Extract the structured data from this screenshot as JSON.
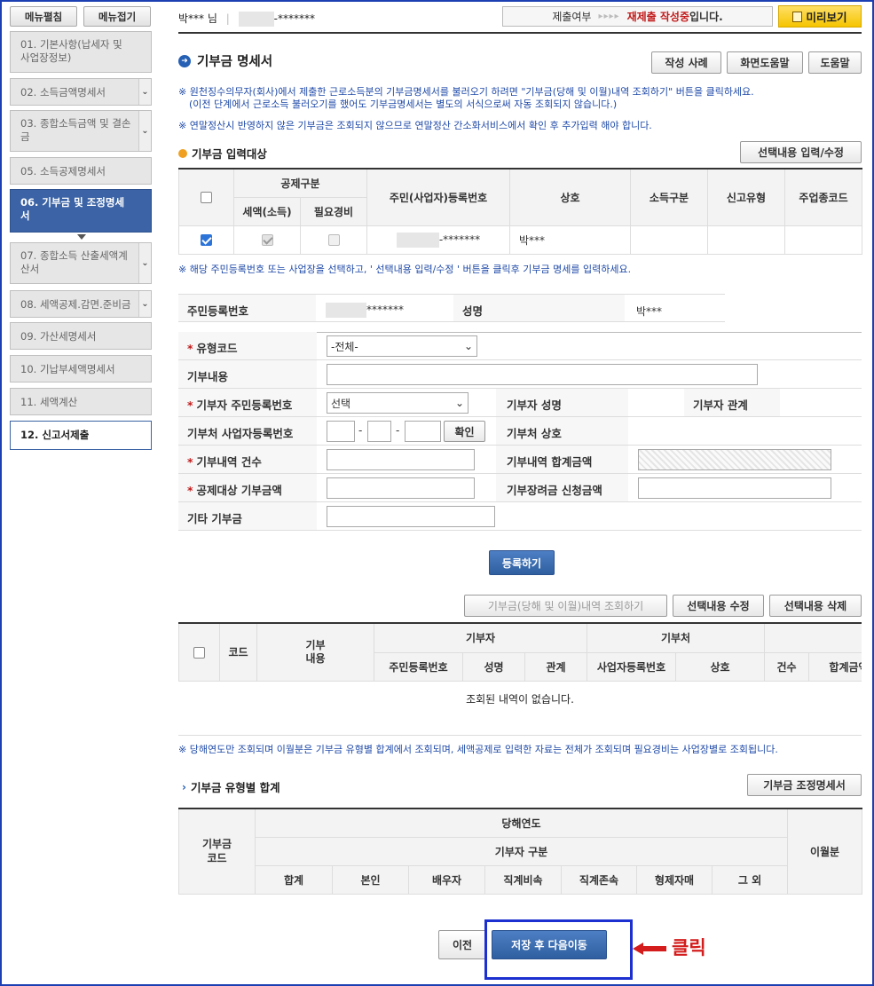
{
  "sidebar": {
    "top_buttons": [
      "메뉴펼침",
      "메뉴접기"
    ],
    "items": [
      {
        "label": "01. 기본사항(납세자 및 사업장정보)",
        "state": "normal",
        "chevron": false
      },
      {
        "label": "02. 소득금액명세서",
        "state": "normal",
        "chevron": true
      },
      {
        "label": "03. 종합소득금액 및 결손금",
        "state": "normal",
        "chevron": true
      },
      {
        "label": "05. 소득공제명세서",
        "state": "normal",
        "chevron": false
      },
      {
        "label": "06. 기부금 및 조정명세서",
        "state": "active",
        "chevron": false
      },
      {
        "label": "07. 종합소득 산출세액계산서",
        "state": "normal",
        "chevron": true
      },
      {
        "label": "08. 세액공제.감면.준비금",
        "state": "normal",
        "chevron": true
      },
      {
        "label": "09. 가산세명세서",
        "state": "normal",
        "chevron": false
      },
      {
        "label": "10. 기납부세액명세서",
        "state": "normal",
        "chevron": false
      },
      {
        "label": "11. 세액계산",
        "state": "normal",
        "chevron": false
      },
      {
        "label": "12. 신고서제출",
        "state": "current",
        "chevron": false
      }
    ]
  },
  "header": {
    "user_name": "박*** 님",
    "user_id_suffix": "-*******",
    "status_label": "제출여부",
    "status_arrows": "▸▸▸▸",
    "status_red": "재제출 작성중",
    "status_tail": "입니다.",
    "preview_label": "미리보기"
  },
  "page": {
    "title": "기부금 명세서",
    "buttons": [
      "작성 사례",
      "화면도움말",
      "도움말"
    ],
    "notes": [
      "※ 원천징수의무자(회사)에서 제출한 근로소득분의 기부금명세서를 불러오기 하려면 \"기부금(당해 및 이월)내역 조회하기\" 버튼을 클릭하세요.",
      "(이전 단계에서 근로소득 불러오기를 했어도 기부금명세서는 별도의 서식으로써 자동 조회되지 않습니다.)",
      "※ 연말정산시 반영하지 않은 기부금은 조회되지 않으므로 연말정산 간소화서비스에서 확인 후 추가입력 해야 합니다."
    ]
  },
  "target": {
    "section_title": "기부금 입력대상",
    "edit_button": "선택내용 입력/수정",
    "headers": {
      "deduction": "공제구분",
      "tax_credit": "세액(소득)",
      "expense": "필요경비",
      "reg_no": "주민(사업자)등록번호",
      "name": "상호",
      "income_type": "소득구분",
      "report_type": "신고유형",
      "industry": "주업종코드"
    },
    "row": {
      "reg_no_suffix": "-*******",
      "name": "박***",
      "checked": true,
      "tax_credit": true,
      "expense": false
    },
    "hint": "※ 해당 주민등록번호 또는 사업장을 선택하고, ' 선택내용 입력/수정 ' 버튼을 클릭후 기부금 명세를 입력하세요."
  },
  "form": {
    "resident_label": "주민등록번호",
    "resident_value_suffix": "*******",
    "name_label": "성명",
    "name_value": "박***",
    "type_label": "유형코드",
    "type_value": "-전체-",
    "content_label": "기부내용",
    "donor_rrn_label": "기부자 주민등록번호",
    "donor_rrn_value": "선택",
    "donor_name_label": "기부자 성명",
    "donor_rel_label": "기부자 관계",
    "recipient_brn_label": "기부처 사업자등록번호",
    "confirm_button": "확인",
    "recipient_name_label": "기부처 상호",
    "count_label": "기부내역 건수",
    "total_label": "기부내역 합계금액",
    "deduct_amount_label": "공제대상 기부금액",
    "scholarship_label": "기부장려금 신청금액",
    "other_label": "기타 기부금",
    "dash": "-"
  },
  "actions": {
    "register": "등록하기",
    "lookup": "기부금(당해 및 이월)내역 조회하기",
    "edit": "선택내용 수정",
    "delete": "선택내용 삭제"
  },
  "list": {
    "headers": {
      "code": "코드",
      "content": "기부\n내용",
      "donor": "기부자",
      "recipient": "기부처",
      "rrn": "주민등록번호",
      "name": "성명",
      "relation": "관계",
      "brn": "사업자등록번호",
      "company": "상호",
      "count": "건수",
      "total": "합계금액"
    },
    "empty": "조회된 내역이 없습니다."
  },
  "footnote": "※ 당해연도만 조회되며 이월분은 기부금 유형별 합계에서 조회되며, 세액공제로 입력한 자료는 전체가 조회되며 필요경비는 사업장별로 조회됩니다.",
  "summary": {
    "section_title": "기부금 유형별 합계",
    "button": "기부금 조정명세서",
    "headers": {
      "code": "기부금\n코드",
      "current_year": "당해연도",
      "donor_type": "기부자 구분",
      "carryover": "이월분",
      "cols": [
        "합계",
        "본인",
        "배우자",
        "직계비속",
        "직계존속",
        "형제자매",
        "그 외"
      ]
    }
  },
  "footer": {
    "prev": "이전",
    "save_next": "저장 후 다음이동",
    "annotation": "클릭"
  },
  "colors": {
    "accent": "#2f5f9f",
    "annotation_red": "#d41c1c",
    "annotation_box": "#1c2fd0"
  }
}
